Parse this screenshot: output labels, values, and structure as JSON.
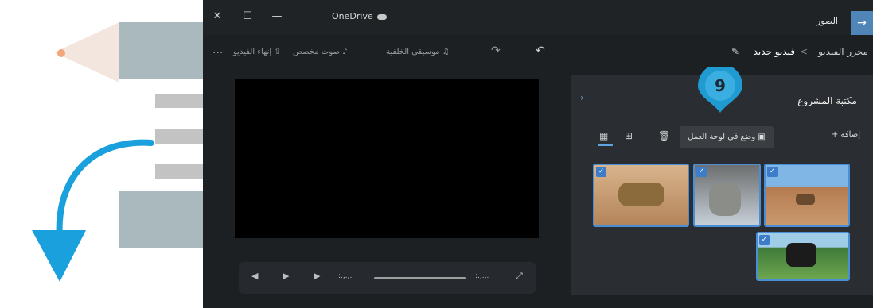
{
  "window": {
    "title": "OneDrive",
    "controls": {
      "close": "✕",
      "maximize": "☐",
      "minimize": "—"
    }
  },
  "nav": {
    "back_icon": "arrow-right-icon",
    "app_name": "الصور"
  },
  "breadcrumb": {
    "root": "محرر الفيديو",
    "separator": "<",
    "current": "فيديو جديد"
  },
  "toolbar": {
    "finish_video": "إنهاء الفيديو",
    "custom_audio": "صوت مخصص",
    "background_music": "موسيقى الخلفية",
    "more": "..."
  },
  "library": {
    "title": "مكتبة المشروع",
    "add_label": "+ إضافة",
    "place_in_storyboard": "وضع في لوحة العمل"
  },
  "media_items": [
    {
      "label": "leopard",
      "selected": true,
      "check": "✓"
    },
    {
      "label": "cat",
      "selected": true,
      "check": "✓"
    },
    {
      "label": "camel",
      "selected": true,
      "check": "✓"
    },
    {
      "label": "horse",
      "selected": true,
      "check": "✓"
    }
  ],
  "player": {
    "current_time": ":.,.,.",
    "total_time": ":.,.,."
  },
  "step_badge": {
    "number": "9"
  },
  "colors": {
    "accent": "#4a8fd6",
    "badge": "#1f9bd1",
    "app_bg": "#1d2023"
  }
}
